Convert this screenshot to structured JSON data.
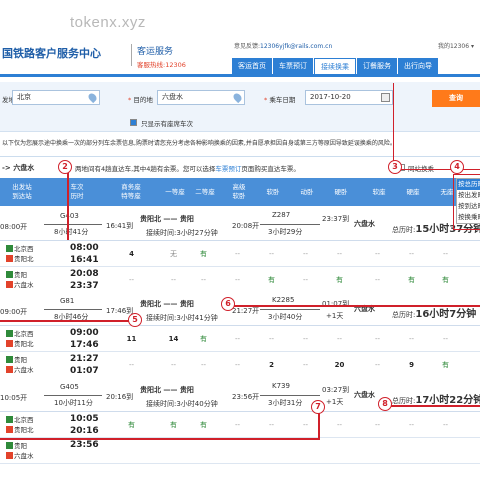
{
  "watermark": "tokenx.xyz",
  "header": {
    "logo": "国铁路客户服务中心",
    "service": "客运服务",
    "hotline": "客服热线:12306",
    "feedback_prefix": "意见反馈:",
    "feedback_email": "12306yjfk@rails.com.cn",
    "links": "我的12306 ▾"
  },
  "nav": [
    "客运首页",
    "车票预订",
    "接续换乘",
    "订餐服务",
    "出行向导"
  ],
  "nav_active_index": 2,
  "search": {
    "from_label": "发地",
    "from_value": "北京",
    "to_label": "目的地",
    "to_value": "六盘水",
    "date_label": "乘车日期",
    "date_value": "2017-10-20",
    "query_button": "查询",
    "only_seats_label": "只显示有座席车次"
  },
  "notice": "以下仅为您展示途中换乘一次的部分列车余票信息,购票时请您充分考虑各种影响换乘的因素,并自愿承担因自身或第三方等原因导致延误换乘的风险。",
  "route": {
    "to": "-> 六盘水",
    "info_prefix": "两地间有",
    "info_count": "4",
    "info_rest": "趟直达车,其中4趟有余票。您可以选择",
    "info_link": "车票预订",
    "info_tail": "页面购买直达车票。",
    "same_station_label": "同站换乘"
  },
  "sort_dropdown": [
    "按总历时",
    "按出发时",
    "按到达时",
    "按换乘时"
  ],
  "table_headers": [
    "出发站\n到达站",
    "车次\n历时",
    "",
    "",
    "商务座\n特等座",
    "一等座",
    "二等座",
    "高级\n软卧",
    "软卧",
    "动卧",
    "硬卧",
    "软座",
    "硬座",
    "无座"
  ],
  "transfers": [
    {
      "dep_time": "08:00开",
      "train1": "G403",
      "train1_dur": "8小时41分",
      "arr1": "16:41到",
      "transfer_a": "贵阳北",
      "transfer_b": "贵阳",
      "waiting": "接续时间:3小时27分钟",
      "dep2": "20:08开",
      "train2": "Z287",
      "train2_dur": "3小时29分",
      "arr2": "23:37到",
      "dest": "六盘水",
      "total_label": "总历时:",
      "total": "15小时37分钟",
      "plus": "",
      "segments": [
        {
          "from": "北京西",
          "to": "贵阳北",
          "dep": "08:00",
          "arr": "16:41",
          "cells": [
            "4",
            "无",
            "有",
            "--",
            "--",
            "--",
            "--",
            "--",
            "--",
            "--"
          ]
        },
        {
          "from": "贵阳",
          "to": "六盘水",
          "dep": "20:08",
          "arr": "23:37",
          "cells": [
            "--",
            "--",
            "--",
            "--",
            "有",
            "--",
            "有",
            "--",
            "有",
            "有"
          ]
        }
      ]
    },
    {
      "dep_time": "09:00开",
      "train1": "G81",
      "train1_dur": "8小时46分",
      "arr1": "17:46到",
      "transfer_a": "贵阳北",
      "transfer_b": "贵阳",
      "waiting": "接续时间:3小时41分钟",
      "dep2": "21:27开",
      "train2": "K2285",
      "train2_dur": "3小时40分",
      "arr2": "01:07到",
      "dest": "六盘水",
      "total_label": "总历时:",
      "total": "16小时7分钟",
      "plus": "+1天",
      "segments": [
        {
          "from": "北京西",
          "to": "贵阳北",
          "dep": "09:00",
          "arr": "17:46",
          "cells": [
            "11",
            "14",
            "有",
            "--",
            "--",
            "--",
            "--",
            "--",
            "--",
            "--"
          ]
        },
        {
          "from": "贵阳",
          "to": "六盘水",
          "dep": "21:27",
          "arr": "01:07",
          "cells": [
            "--",
            "--",
            "--",
            "--",
            "2",
            "--",
            "20",
            "--",
            "9",
            "有"
          ]
        }
      ]
    },
    {
      "dep_time": "10:05开",
      "train1": "G405",
      "train1_dur": "10小时11分",
      "arr1": "20:16到",
      "transfer_a": "贵阳北",
      "transfer_b": "贵阳",
      "waiting": "接续时间:3小时40分钟",
      "dep2": "23:56开",
      "train2": "K739",
      "train2_dur": "3小时31分",
      "arr2": "03:27到",
      "dest": "六盘水",
      "total_label": "总历时:",
      "total": "17小时22分钟",
      "plus": "+1天",
      "segments": [
        {
          "from": "北京西",
          "to": "贵阳北",
          "dep": "10:05",
          "arr": "20:16",
          "cells": [
            "有",
            "有",
            "有",
            "--",
            "--",
            "--",
            "--",
            "--",
            "--",
            "--"
          ]
        },
        {
          "from": "贵阳",
          "to": "六盘水",
          "dep": "23:56",
          "arr": "",
          "cells": [
            "",
            "",
            "",
            "",
            "",
            "",
            "",
            "",
            "",
            ""
          ]
        }
      ]
    }
  ],
  "markers": [
    "2",
    "3",
    "4",
    "5",
    "6",
    "7",
    "8"
  ],
  "colors": {
    "brand_blue": "#2d7fd4",
    "orange": "#ff7a1a",
    "marker_red": "#d0202a"
  }
}
